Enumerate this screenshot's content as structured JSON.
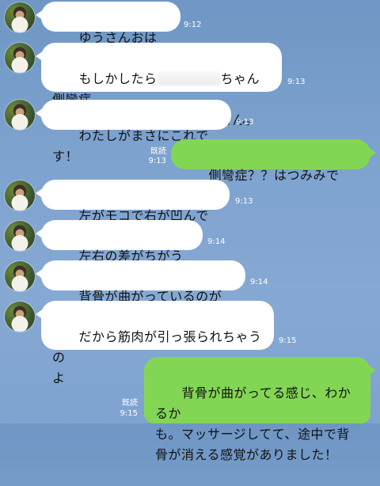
{
  "messages": [
    {
      "direction": "in",
      "text": "ゆうさんおはよう",
      "time": "9:12"
    },
    {
      "direction": "in",
      "text_before": "もしかしたら",
      "text_after": "ちゃん側彎症\n(そくわん)があるかもしれません。",
      "time": "9:13"
    },
    {
      "direction": "in",
      "text": "わたしがまさにこれです！",
      "time": "9:13"
    },
    {
      "direction": "out",
      "text": "側彎症？？はつみみです！！",
      "read": "既読",
      "time": "9:13"
    },
    {
      "direction": "in",
      "text": "左がモコで右が凹んでいる",
      "time": "9:13"
    },
    {
      "direction": "in",
      "text": "左右の差がちがうの。",
      "time": "9:14"
    },
    {
      "direction": "in",
      "text": "背骨が曲がっているのが原因",
      "time": "9:14"
    },
    {
      "direction": "in",
      "text": "だから筋肉が引っ張られちゃうの\nよ",
      "time": "9:15"
    },
    {
      "direction": "out",
      "text": "背骨が曲がってる感じ、わかるか\nも。マッサージしてて、途中で背\n骨が消える感覚がありました！",
      "read": "既読",
      "time": "9:15"
    }
  ]
}
